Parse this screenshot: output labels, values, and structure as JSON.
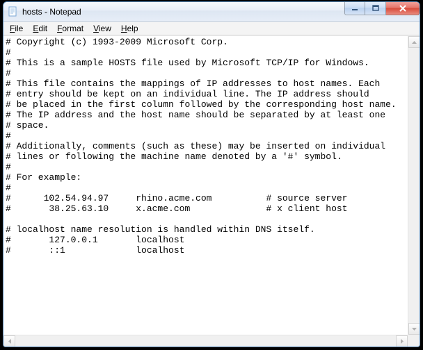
{
  "window": {
    "title": "hosts - Notepad"
  },
  "menu": {
    "file": "File",
    "edit": "Edit",
    "format": "Format",
    "view": "View",
    "help": "Help"
  },
  "document": {
    "text": "# Copyright (c) 1993-2009 Microsoft Corp.\n#\n# This is a sample HOSTS file used by Microsoft TCP/IP for Windows.\n#\n# This file contains the mappings of IP addresses to host names. Each\n# entry should be kept on an individual line. The IP address should\n# be placed in the first column followed by the corresponding host name.\n# The IP address and the host name should be separated by at least one\n# space.\n#\n# Additionally, comments (such as these) may be inserted on individual\n# lines or following the machine name denoted by a '#' symbol.\n#\n# For example:\n#\n#      102.54.94.97     rhino.acme.com          # source server\n#       38.25.63.10     x.acme.com              # x client host\n\n# localhost name resolution is handled within DNS itself.\n#       127.0.0.1       localhost\n#       ::1             localhost"
  }
}
